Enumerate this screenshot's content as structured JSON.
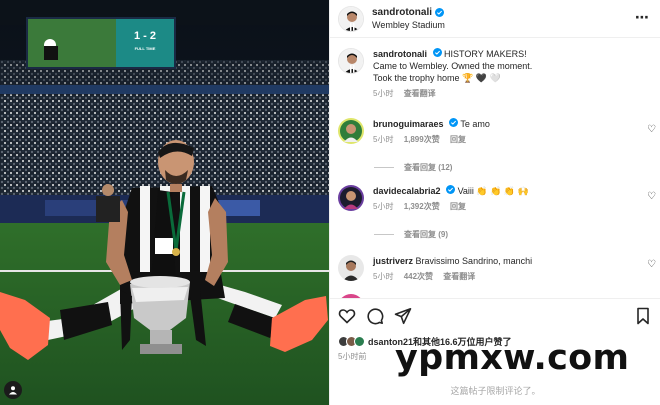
{
  "post": {
    "username": "sandrotonali",
    "location": "Wembley Stadium",
    "more_icon": "⋯"
  },
  "caption": {
    "username": "sandrotonali",
    "line1": "HISTORY MAKERS!",
    "line2": "Came to Wembley. Owned the moment.",
    "line3": "Took the trophy home 🏆 🖤 🤍",
    "time": "5小时",
    "translate": "查看翻译"
  },
  "comments": [
    {
      "username": "brunoguimaraes",
      "text": "Te amo",
      "time": "5小时",
      "likes": "1,899次赞",
      "action": "回复",
      "replies": "查看回复 (12)"
    },
    {
      "username": "davidecalabria2",
      "text": "Vaiii 👏 👏 👏 🙌",
      "time": "5小时",
      "likes": "1,392次赞",
      "action": "回复",
      "replies": "查看回复 (9)"
    },
    {
      "username": "justriverz",
      "text": "Bravissimo Sandrino, manchi",
      "time": "5小时",
      "likes": "442次赞",
      "action": "查看翻译"
    }
  ],
  "photo": {
    "scoreboard_score": "1 - 2",
    "scoreboard_status": "FULL TIME"
  },
  "likes": {
    "liker": "dsanton21",
    "rest": "和其他16.6万位用户赞了",
    "time": "5小时前"
  },
  "comments_limited": "这篇帖子限制评论了。",
  "watermark": "ypmxw.com",
  "icons": [
    "verified-badge-icon",
    "heart-icon",
    "comment-icon",
    "share-icon",
    "bookmark-icon",
    "more-icon"
  ],
  "colors": {
    "verified": "#0095f6",
    "secondary_text": "#8e8e8e",
    "newcastle_black": "#111111",
    "pitch_green": "#2e6b2c"
  }
}
